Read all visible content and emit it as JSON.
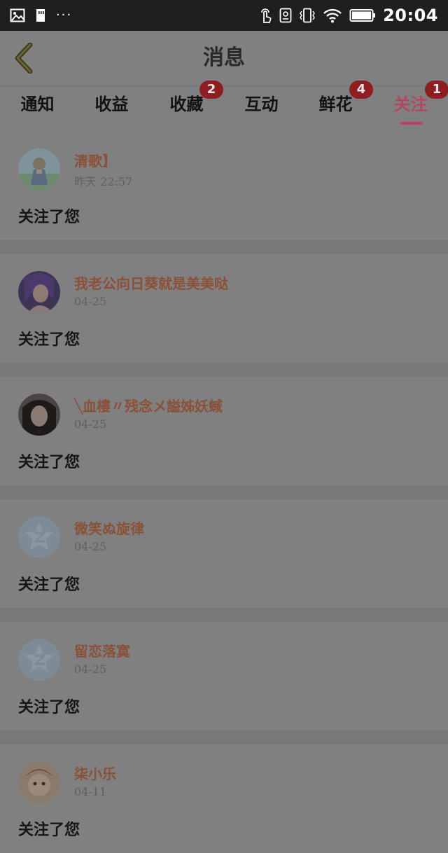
{
  "status_bar": {
    "time": "20:04",
    "left_icons": [
      "image-icon",
      "sd-card-icon",
      "more-dots-icon"
    ],
    "more_dots": "···",
    "right_icons": [
      "touch-icon",
      "screenshot-icon",
      "vibrate-icon",
      "wifi-icon",
      "battery-icon"
    ]
  },
  "header": {
    "title": "消息",
    "back_icon": "chevron-left-icon"
  },
  "tabs": [
    {
      "label": "通知",
      "badge": null,
      "active": false
    },
    {
      "label": "收益",
      "badge": null,
      "active": false
    },
    {
      "label": "收藏",
      "badge": "2",
      "active": false
    },
    {
      "label": "互动",
      "badge": null,
      "active": false
    },
    {
      "label": "鲜花",
      "badge": "4",
      "active": false
    },
    {
      "label": "关注",
      "badge": "1",
      "active": true
    }
  ],
  "messages": [
    {
      "user": "清歌】",
      "time": "昨天 22:57",
      "text": "关注了您",
      "avatar": "anime-girl-avatar"
    },
    {
      "user": "我老公向日葵就是美美哒",
      "time": "04-25",
      "text": "关注了您",
      "avatar": "purple-hair-avatar"
    },
    {
      "user": "╲血樓〃残念メ謚姊妖蜮",
      "time": "04-25",
      "text": "关注了您",
      "avatar": "photo-avatar"
    },
    {
      "user": "微笑ぬ旋律",
      "time": "04-25",
      "text": "关注了您",
      "avatar": "default-qq-avatar"
    },
    {
      "user": "留恋落寞",
      "time": "04-25",
      "text": "关注了您",
      "avatar": "default-qq-avatar"
    },
    {
      "user": "柒小乐",
      "time": "04-11",
      "text": "关注了您",
      "avatar": "cartoon-avatar"
    }
  ],
  "colors": {
    "overlay_background": "#7f7f7f",
    "accent": "#b34760",
    "badge": "#8f1e23",
    "username": "#8a5038",
    "statusbar": "#1f1f1f"
  }
}
